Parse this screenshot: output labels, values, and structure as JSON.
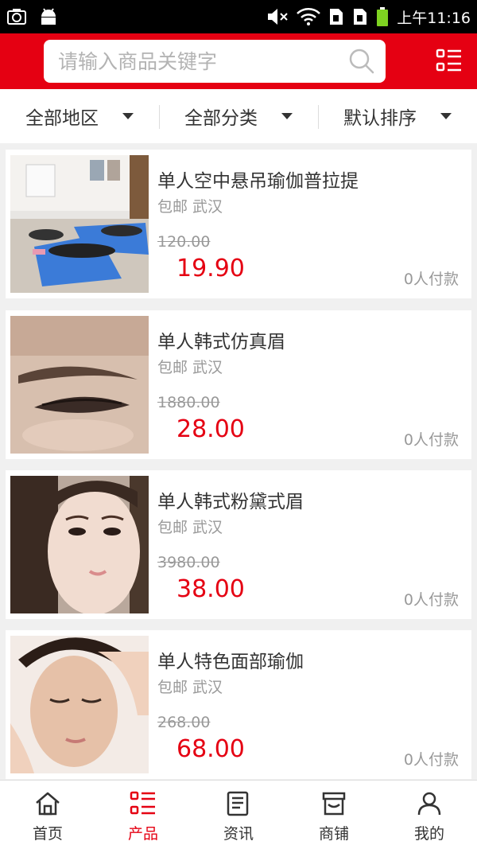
{
  "status_bar": {
    "time": "上午11:16"
  },
  "search": {
    "placeholder": "请输入商品关键字"
  },
  "filters": [
    {
      "label": "全部地区"
    },
    {
      "label": "全部分类"
    },
    {
      "label": "默认排序"
    }
  ],
  "products": [
    {
      "title": "单人空中悬吊瑜伽普拉提",
      "shipping": "包邮",
      "city": "武汉",
      "original_price": "120.00",
      "price": "19.90",
      "paid": "0人付款"
    },
    {
      "title": "单人韩式仿真眉",
      "shipping": "包邮",
      "city": "武汉",
      "original_price": "1880.00",
      "price": "28.00",
      "paid": "0人付款"
    },
    {
      "title": "单人韩式粉黛式眉",
      "shipping": "包邮",
      "city": "武汉",
      "original_price": "3980.00",
      "price": "38.00",
      "paid": "0人付款"
    },
    {
      "title": "单人特色面部瑜伽",
      "shipping": "包邮",
      "city": "武汉",
      "original_price": "268.00",
      "price": "68.00",
      "paid": "0人付款"
    }
  ],
  "tabbar": {
    "items": [
      {
        "label": "首页",
        "icon": "home-icon",
        "active": false
      },
      {
        "label": "产品",
        "icon": "product-list-icon",
        "active": true
      },
      {
        "label": "资讯",
        "icon": "news-icon",
        "active": false
      },
      {
        "label": "商铺",
        "icon": "shop-icon",
        "active": false
      },
      {
        "label": "我的",
        "icon": "user-icon",
        "active": false
      }
    ]
  },
  "colors": {
    "brand_red": "#e50012",
    "text": "#333333",
    "muted": "#999999"
  }
}
